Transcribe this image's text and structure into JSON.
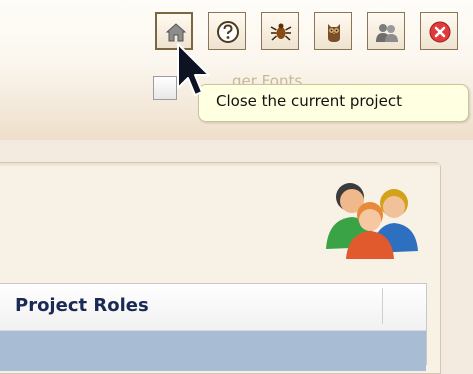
{
  "toolbar": {
    "buttons": [
      {
        "icon": "home-icon",
        "active": true
      },
      {
        "icon": "help-icon"
      },
      {
        "icon": "bug-icon"
      },
      {
        "icon": "owl-icon"
      },
      {
        "icon": "users-icon"
      },
      {
        "icon": "close-circle-icon"
      }
    ]
  },
  "background_label": "ger Fonts",
  "tooltip": {
    "text": "Close the current project"
  },
  "table": {
    "header": "Project Roles"
  },
  "colors": {
    "header_bg": "#f7efe3",
    "tooltip_bg": "#ffffe1",
    "table_header_text": "#1a2a55",
    "selected_row": "#a8bdd3"
  }
}
